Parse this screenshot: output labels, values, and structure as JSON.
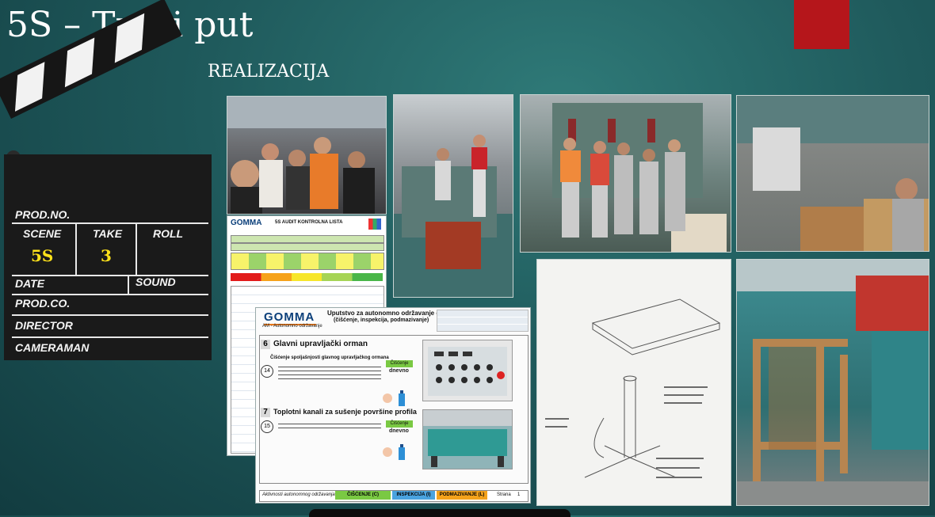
{
  "slide": {
    "title": "5S – Treći put",
    "subtitle": "REALIZACIJA",
    "accent_color": "#b5161b"
  },
  "clapperboard": {
    "prod_no": "PROD.NO.",
    "scene_label": "SCENE",
    "take_label": "TAKE",
    "roll_label": "ROLL",
    "scene_value": "5S",
    "take_value": "3",
    "date_label": "DATE",
    "sound_label": "SOUND",
    "prod_co_label": "PROD.CO.",
    "director_label": "DIRECTOR",
    "cameraman_label": "CAMERAMAN"
  },
  "audit_sheet": {
    "logo": "GOMMA",
    "title": "5S AUDIT KONTROLNA LISTA"
  },
  "instruction_sheet": {
    "logo": "GOMMA",
    "title_line1": "Uputstvo za autonomno održavanje opreme",
    "title_line2": "(čišćenje, inspekcija, podmazivanje)",
    "subtitle": "AM - Autonomno održavanje",
    "section6_num": "6",
    "section6_title": "Glavni upravljački orman",
    "section6_sub": "Čišćenje spoljašnjosti glavnog upravljačkog ormana",
    "step14": "14",
    "clean_label": "Čišćenje",
    "freq_label": "dnevno",
    "section7_num": "7",
    "section7_title": "Toplotni kanali za sušenje površine profila",
    "step15": "15",
    "footer_label": "Aktivnosti autonomnog održavanja:",
    "footer_clean": "ČIŠĆENJE (C)",
    "footer_inspect": "INSPEKCIJA (I)",
    "footer_lube": "PODMAZIVANJE (L)",
    "footer_page_label": "Strana",
    "footer_page": "1",
    "colors": {
      "green": "#7ac943",
      "blue": "#4aa3df",
      "orange": "#f4a21b"
    }
  },
  "photos": [
    {
      "name": "team-selfie-photo"
    },
    {
      "name": "machine-cleaning-photo"
    },
    {
      "name": "team-at-machine-photo"
    },
    {
      "name": "worker-with-box-photo"
    },
    {
      "name": "sketch-drawing-photo"
    },
    {
      "name": "wooden-stand-photo"
    }
  ]
}
